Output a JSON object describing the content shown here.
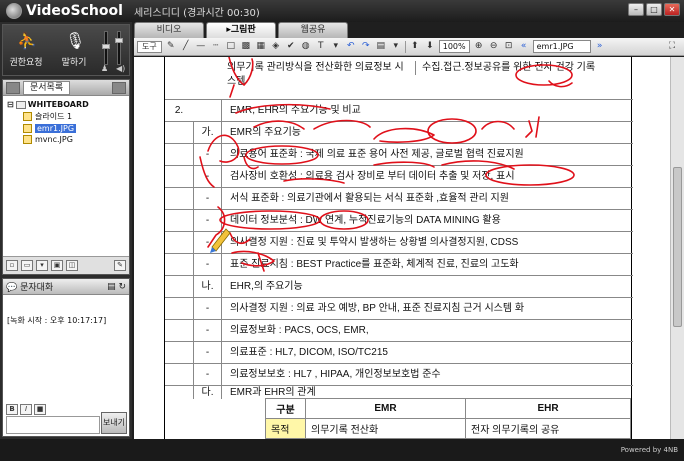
{
  "app": {
    "logo": "VideoSchool",
    "session_title": "세리스디디 (경과시간 00:30)",
    "powered_by": "Powered by 4NB"
  },
  "media": {
    "request_label": "권한요청",
    "mic_label": "말하기"
  },
  "docs": {
    "tab_label": "문서목록",
    "root": "WHITEBOARD",
    "items": [
      {
        "label": "슬라이드 1",
        "selected": false
      },
      {
        "label": "emr1.JPG",
        "selected": true
      },
      {
        "label": "mvnc.JPG",
        "selected": false
      }
    ]
  },
  "chat": {
    "title": "문자대화",
    "log": "[녹화 시작 : 오후 10:17:17]",
    "send_label": "보내기"
  },
  "tabs": [
    {
      "label": "비디오",
      "active": false
    },
    {
      "label": "▸그림판",
      "active": true
    },
    {
      "label": "웹공유",
      "active": false
    }
  ],
  "toolbar": {
    "tool_label": "도구",
    "zoom": "100%",
    "page": "emr1.JPG"
  },
  "doc": {
    "top_left": "의무기록 관리방식을 전산화한 의료정보 시스템",
    "top_right": "수집.접근.정보공유를 위한 전자 건강 기록",
    "section2_num": "2.",
    "section2_title": "EMR, EHR의 주요기능 및 비교",
    "ga": "가.",
    "ga_title": "EMR의 주요기능",
    "dash": "-",
    "ga_items": [
      "의료용어 표준화 : 국제 의료 표준 용어 사전 제공, 글로벌 협력 진료지원",
      "검사장비 호환성 : 의료용 검사 장비로 부터 데이터 추출 및 저장, 표시",
      "서식 표준화 : 의료기관에서 활용되는 서식 표준화 ,효율적 관리 지원",
      "데이터 정보분석 : DW 연계, 누적진료기능의 DATA MINING 활용",
      "의사결정 지원 : 진료 및 투약시 발생하는 상황별 의사결정지원, CDSS",
      "표준 진료지침 : BEST Practice를 표준화, 체계적 진료, 진료의 고도화"
    ],
    "na": "나.",
    "na_title": "EHR,의 주요기능",
    "na_items": [
      "의사결정 지원 : 의료 과오 예방, BP 안내, 표준 진료지침 근거 시스템 화",
      "의료정보화 : PACS, OCS, EMR,",
      "의료표준 : HL7, DICOM, ISO/TC215",
      "의료정보보호 : HL7 , HIPAA, 개인정보보호법 준수"
    ],
    "da": "다.",
    "da_title": "EMR과 EHR의 관계",
    "table": {
      "headers": [
        "구분",
        "EMR",
        "EHR"
      ],
      "row": [
        "목적",
        "의무기록 전산화",
        "전자 의무기록의 공유"
      ]
    }
  }
}
